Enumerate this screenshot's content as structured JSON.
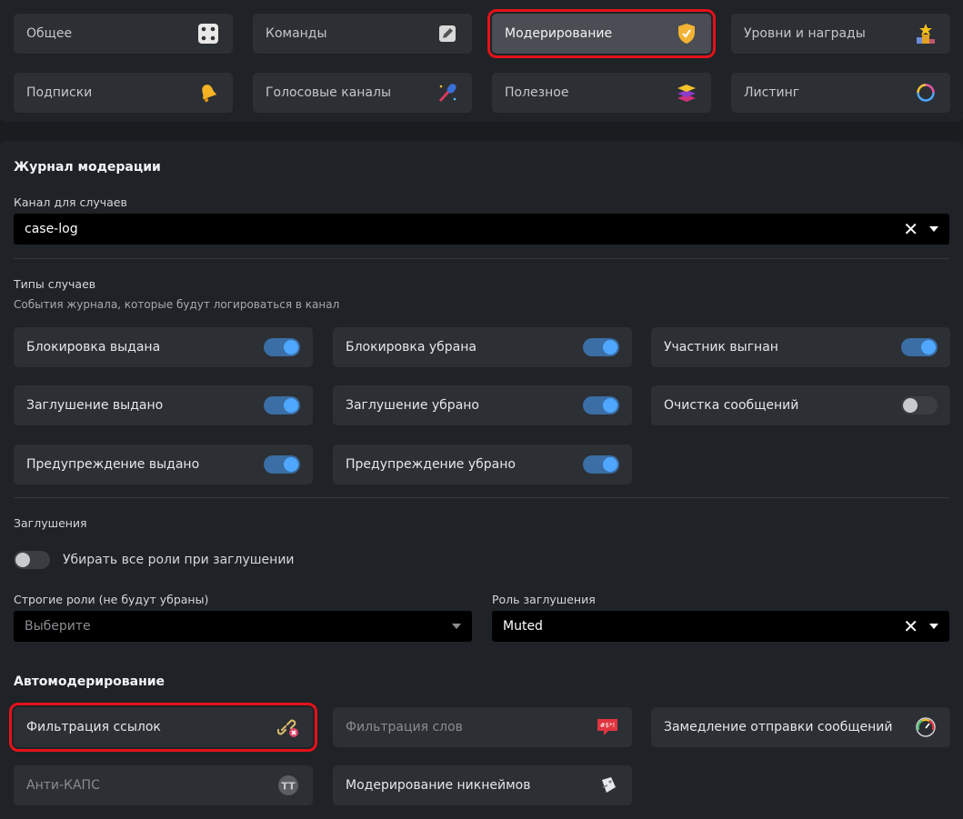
{
  "nav": [
    {
      "label": "Общее",
      "icon": "dice-icon",
      "active": false
    },
    {
      "label": "Команды",
      "icon": "edit-icon",
      "active": false
    },
    {
      "label": "Модерирование",
      "icon": "shield-icon",
      "active": true
    },
    {
      "label": "Уровни и награды",
      "icon": "trophy-podium-icon",
      "active": false
    },
    {
      "label": "Подписки",
      "icon": "bell-icon",
      "active": false
    },
    {
      "label": "Голосовые каналы",
      "icon": "microphone-icon",
      "active": false
    },
    {
      "label": "Полезное",
      "icon": "stack-icon",
      "active": false
    },
    {
      "label": "Листинг",
      "icon": "ring-icon",
      "active": false
    }
  ],
  "modlog": {
    "title": "Журнал модерации",
    "channel_label": "Канал для случаев",
    "channel_value": "case-log",
    "types_title": "Типы случаев",
    "types_desc": "События журнала, которые будут логироваться в канал",
    "types": [
      {
        "label": "Блокировка выдана",
        "on": true
      },
      {
        "label": "Блокировка убрана",
        "on": true
      },
      {
        "label": "Участник выгнан",
        "on": true
      },
      {
        "label": "Заглушение выдано",
        "on": true
      },
      {
        "label": "Заглушение убрано",
        "on": true
      },
      {
        "label": "Очистка сообщений",
        "on": false
      },
      {
        "label": "Предупреждение выдано",
        "on": true
      },
      {
        "label": "Предупреждение убрано",
        "on": true
      }
    ]
  },
  "mutes": {
    "title": "Заглушения",
    "remove_roles_label": "Убирать все роли при заглушении",
    "remove_roles_on": false,
    "strict_roles_label": "Строгие роли (не будут убраны)",
    "strict_roles_placeholder": "Выберите",
    "mute_role_label": "Роль заглушения",
    "mute_role_value": "Muted"
  },
  "automod": {
    "title": "Автомодерирование",
    "items": [
      {
        "label": "Фильтрация ссылок",
        "icon": "broken-link-icon",
        "enabled": true
      },
      {
        "label": "Фильтрация слов",
        "icon": "censored-speech-icon",
        "enabled": false
      },
      {
        "label": "Замедление отправки сообщений",
        "icon": "speedometer-icon",
        "enabled": true
      },
      {
        "label": "Анти-КАПС",
        "icon": "tt-caps-icon",
        "enabled": false
      },
      {
        "label": "Модерирование никнеймов",
        "icon": "name-tag-icon",
        "enabled": true
      }
    ]
  },
  "colors": {
    "accent": "#4fa7ff",
    "highlight": "#e3121a",
    "bg": "#1a1c20",
    "panel": "#1f2226",
    "card": "#2c2f34"
  }
}
